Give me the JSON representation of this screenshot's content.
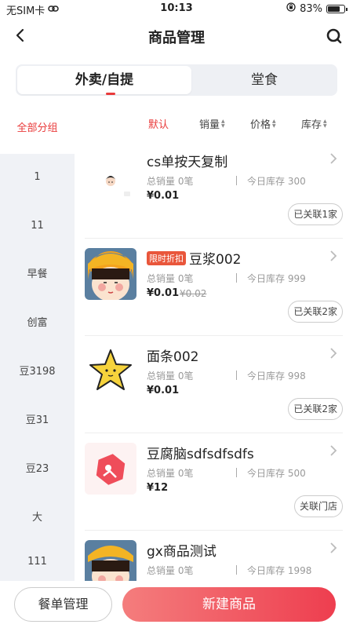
{
  "status_bar": {
    "carrier": "无SIM卡",
    "time": "10:13",
    "battery": "83%",
    "battery_level": 0.83
  },
  "header": {
    "title": "商品管理"
  },
  "tabs": [
    {
      "label": "外卖/自提",
      "active": true
    },
    {
      "label": "堂食",
      "active": false
    }
  ],
  "sidebar": {
    "items": [
      {
        "label": "全部分组",
        "active": true
      },
      {
        "label": "1"
      },
      {
        "label": "11"
      },
      {
        "label": "早餐"
      },
      {
        "label": "创富"
      },
      {
        "label": "豆3198"
      },
      {
        "label": "豆31"
      },
      {
        "label": "豆23"
      },
      {
        "label": "大"
      },
      {
        "label": "111"
      }
    ]
  },
  "sort": {
    "default": "默认",
    "sales": "销量",
    "price": "价格",
    "stock": "库存"
  },
  "products": [
    {
      "name": "cs单按天复制",
      "promo": "",
      "sales": "总销量 0笔",
      "stock": "今日库存 300",
      "price": "¥0.01",
      "original_price": "",
      "link": "已关联1家",
      "icon": "girl-avatar-small-icon"
    },
    {
      "name": "豆浆002",
      "promo": "限时折扣",
      "sales": "总销量 0笔",
      "stock": "今日库存 999",
      "price": "¥0.01",
      "original_price": "¥0.02",
      "link": "已关联2家",
      "icon": "maruko-avatar-icon"
    },
    {
      "name": "面条002",
      "promo": "",
      "sales": "总销量 0笔",
      "stock": "今日库存 998",
      "price": "¥0.01",
      "original_price": "",
      "link": "已关联2家",
      "icon": "star-icon"
    },
    {
      "name": "豆腐脑sdfsdfsdfs",
      "promo": "",
      "sales": "总销量 0笔",
      "stock": "今日库存 500",
      "price": "¥12",
      "original_price": "",
      "link": "关联门店",
      "icon": "placeholder-image-icon"
    },
    {
      "name": "gx商品测试",
      "promo": "",
      "sales": "总销量 0笔",
      "stock": "今日库存 1998",
      "price": "",
      "original_price": "",
      "link": "",
      "icon": "maruko-avatar-icon"
    }
  ],
  "footer": {
    "menu_button": "餐单管理",
    "new_button": "新建商品"
  },
  "colors": {
    "accent": "#e93a3a",
    "promo": "#e9563b"
  }
}
